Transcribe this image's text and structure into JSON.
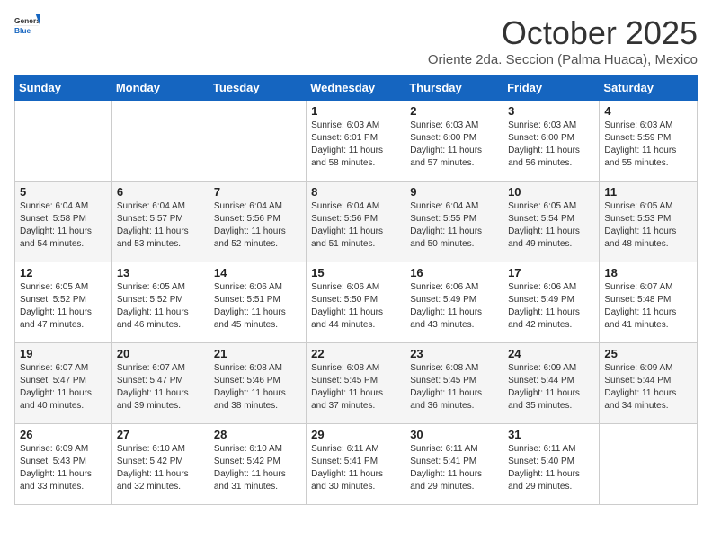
{
  "header": {
    "logo_general": "General",
    "logo_blue": "Blue",
    "month_year": "October 2025",
    "location": "Oriente 2da. Seccion (Palma Huaca), Mexico"
  },
  "days_of_week": [
    "Sunday",
    "Monday",
    "Tuesday",
    "Wednesday",
    "Thursday",
    "Friday",
    "Saturday"
  ],
  "weeks": [
    [
      {
        "day": "",
        "info": ""
      },
      {
        "day": "",
        "info": ""
      },
      {
        "day": "",
        "info": ""
      },
      {
        "day": "1",
        "info": "Sunrise: 6:03 AM\nSunset: 6:01 PM\nDaylight: 11 hours and 58 minutes."
      },
      {
        "day": "2",
        "info": "Sunrise: 6:03 AM\nSunset: 6:00 PM\nDaylight: 11 hours and 57 minutes."
      },
      {
        "day": "3",
        "info": "Sunrise: 6:03 AM\nSunset: 6:00 PM\nDaylight: 11 hours and 56 minutes."
      },
      {
        "day": "4",
        "info": "Sunrise: 6:03 AM\nSunset: 5:59 PM\nDaylight: 11 hours and 55 minutes."
      }
    ],
    [
      {
        "day": "5",
        "info": "Sunrise: 6:04 AM\nSunset: 5:58 PM\nDaylight: 11 hours and 54 minutes."
      },
      {
        "day": "6",
        "info": "Sunrise: 6:04 AM\nSunset: 5:57 PM\nDaylight: 11 hours and 53 minutes."
      },
      {
        "day": "7",
        "info": "Sunrise: 6:04 AM\nSunset: 5:56 PM\nDaylight: 11 hours and 52 minutes."
      },
      {
        "day": "8",
        "info": "Sunrise: 6:04 AM\nSunset: 5:56 PM\nDaylight: 11 hours and 51 minutes."
      },
      {
        "day": "9",
        "info": "Sunrise: 6:04 AM\nSunset: 5:55 PM\nDaylight: 11 hours and 50 minutes."
      },
      {
        "day": "10",
        "info": "Sunrise: 6:05 AM\nSunset: 5:54 PM\nDaylight: 11 hours and 49 minutes."
      },
      {
        "day": "11",
        "info": "Sunrise: 6:05 AM\nSunset: 5:53 PM\nDaylight: 11 hours and 48 minutes."
      }
    ],
    [
      {
        "day": "12",
        "info": "Sunrise: 6:05 AM\nSunset: 5:52 PM\nDaylight: 11 hours and 47 minutes."
      },
      {
        "day": "13",
        "info": "Sunrise: 6:05 AM\nSunset: 5:52 PM\nDaylight: 11 hours and 46 minutes."
      },
      {
        "day": "14",
        "info": "Sunrise: 6:06 AM\nSunset: 5:51 PM\nDaylight: 11 hours and 45 minutes."
      },
      {
        "day": "15",
        "info": "Sunrise: 6:06 AM\nSunset: 5:50 PM\nDaylight: 11 hours and 44 minutes."
      },
      {
        "day": "16",
        "info": "Sunrise: 6:06 AM\nSunset: 5:49 PM\nDaylight: 11 hours and 43 minutes."
      },
      {
        "day": "17",
        "info": "Sunrise: 6:06 AM\nSunset: 5:49 PM\nDaylight: 11 hours and 42 minutes."
      },
      {
        "day": "18",
        "info": "Sunrise: 6:07 AM\nSunset: 5:48 PM\nDaylight: 11 hours and 41 minutes."
      }
    ],
    [
      {
        "day": "19",
        "info": "Sunrise: 6:07 AM\nSunset: 5:47 PM\nDaylight: 11 hours and 40 minutes."
      },
      {
        "day": "20",
        "info": "Sunrise: 6:07 AM\nSunset: 5:47 PM\nDaylight: 11 hours and 39 minutes."
      },
      {
        "day": "21",
        "info": "Sunrise: 6:08 AM\nSunset: 5:46 PM\nDaylight: 11 hours and 38 minutes."
      },
      {
        "day": "22",
        "info": "Sunrise: 6:08 AM\nSunset: 5:45 PM\nDaylight: 11 hours and 37 minutes."
      },
      {
        "day": "23",
        "info": "Sunrise: 6:08 AM\nSunset: 5:45 PM\nDaylight: 11 hours and 36 minutes."
      },
      {
        "day": "24",
        "info": "Sunrise: 6:09 AM\nSunset: 5:44 PM\nDaylight: 11 hours and 35 minutes."
      },
      {
        "day": "25",
        "info": "Sunrise: 6:09 AM\nSunset: 5:44 PM\nDaylight: 11 hours and 34 minutes."
      }
    ],
    [
      {
        "day": "26",
        "info": "Sunrise: 6:09 AM\nSunset: 5:43 PM\nDaylight: 11 hours and 33 minutes."
      },
      {
        "day": "27",
        "info": "Sunrise: 6:10 AM\nSunset: 5:42 PM\nDaylight: 11 hours and 32 minutes."
      },
      {
        "day": "28",
        "info": "Sunrise: 6:10 AM\nSunset: 5:42 PM\nDaylight: 11 hours and 31 minutes."
      },
      {
        "day": "29",
        "info": "Sunrise: 6:11 AM\nSunset: 5:41 PM\nDaylight: 11 hours and 30 minutes."
      },
      {
        "day": "30",
        "info": "Sunrise: 6:11 AM\nSunset: 5:41 PM\nDaylight: 11 hours and 29 minutes."
      },
      {
        "day": "31",
        "info": "Sunrise: 6:11 AM\nSunset: 5:40 PM\nDaylight: 11 hours and 29 minutes."
      },
      {
        "day": "",
        "info": ""
      }
    ]
  ]
}
